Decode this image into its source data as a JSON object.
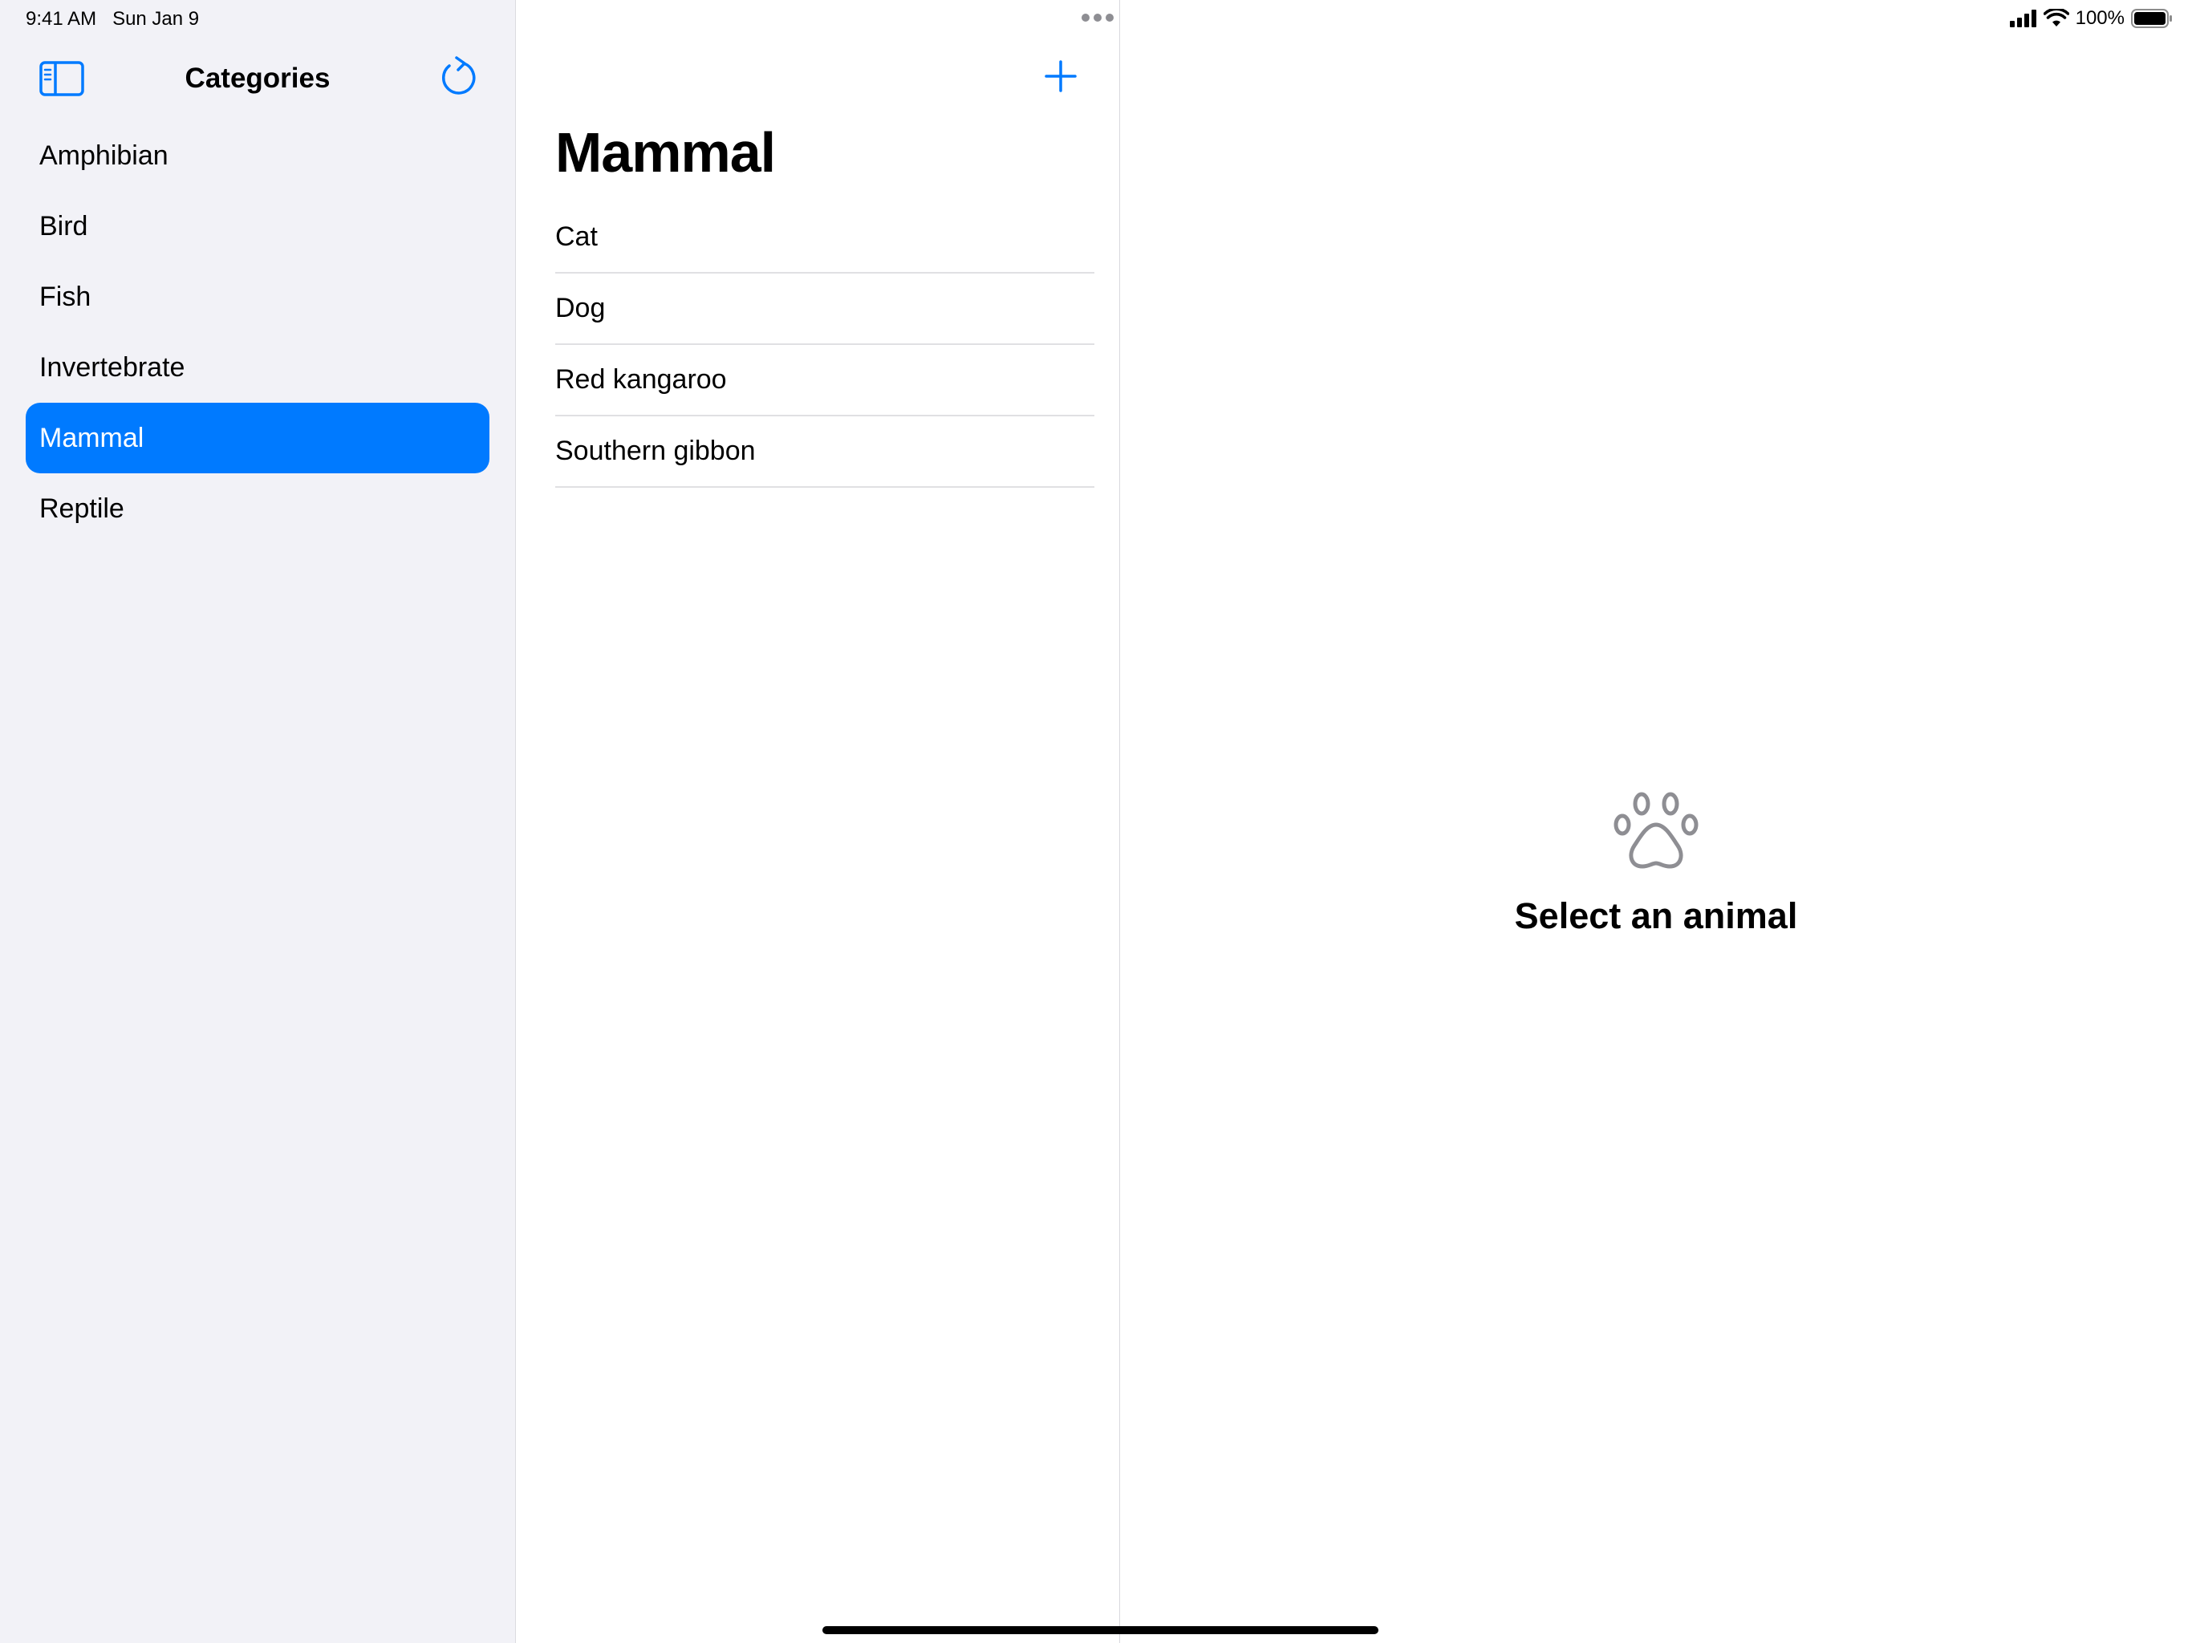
{
  "status_bar": {
    "time": "9:41 AM",
    "date": "Sun Jan 9",
    "battery": "100%"
  },
  "sidebar": {
    "title": "Categories",
    "items": [
      {
        "label": "Amphibian"
      },
      {
        "label": "Bird"
      },
      {
        "label": "Fish"
      },
      {
        "label": "Invertebrate"
      },
      {
        "label": "Mammal",
        "selected": true
      },
      {
        "label": "Reptile"
      }
    ]
  },
  "content": {
    "title": "Mammal",
    "animals": [
      {
        "label": "Cat"
      },
      {
        "label": "Dog"
      },
      {
        "label": "Red kangaroo"
      },
      {
        "label": "Southern gibbon"
      }
    ]
  },
  "detail": {
    "placeholder": "Select an animal",
    "icon": "pawprint-icon"
  },
  "colors": {
    "accent": "#007aff",
    "sidebar_bg": "#f2f2f7",
    "icon_gray": "#8e8e93"
  }
}
